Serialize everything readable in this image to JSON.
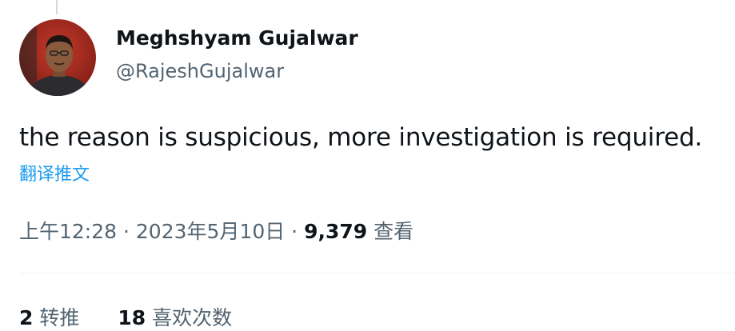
{
  "author": {
    "display_name": "Meghshyam Gujalwar",
    "handle": "@RajeshGujalwar"
  },
  "tweet": {
    "text": "the reason is suspicious, more investigation is required.",
    "translate_label": "翻译推文"
  },
  "meta": {
    "time": "上午12:28",
    "separator": " · ",
    "date": "2023年5月10日",
    "views_count": "9,379",
    "views_label": "查看"
  },
  "stats": {
    "retweets_count": "2",
    "retweets_label": "转推",
    "likes_count": "18",
    "likes_label": "喜欢次数"
  },
  "colors": {
    "text_primary": "#0f1419",
    "text_secondary": "#536471",
    "link": "#1d9bf0",
    "divider": "#eff3f4"
  }
}
